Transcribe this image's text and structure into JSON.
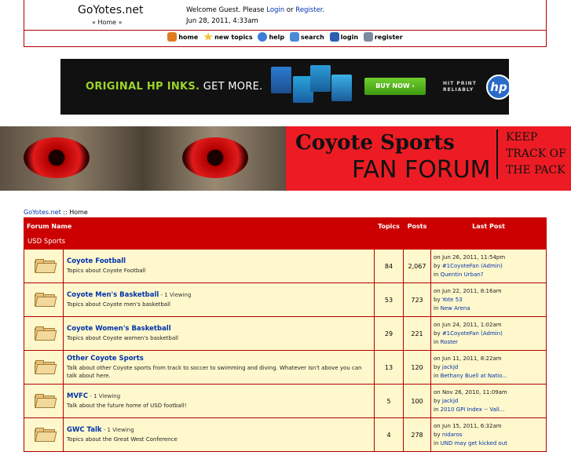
{
  "header": {
    "site_title": "GoYotes.net",
    "home_crumb": "« Home »",
    "welcome_prefix": "Welcome Guest. Please ",
    "login_link": "Login",
    "or_text": " or ",
    "register_link": "Register",
    "welcome_suffix": ".",
    "date": "Jun 28, 2011, 4:33am"
  },
  "toolbar": [
    {
      "label": "home",
      "icon": "home-icon",
      "color": "#e07b20"
    },
    {
      "label": "new topics",
      "icon": "star-icon",
      "color": "#f1c232"
    },
    {
      "label": "help",
      "icon": "help-icon",
      "color": "#3d7fd6"
    },
    {
      "label": "search",
      "icon": "search-icon",
      "color": "#4a8bd8"
    },
    {
      "label": "login",
      "icon": "login-icon",
      "color": "#2c5fb0"
    },
    {
      "label": "register",
      "icon": "register-icon",
      "color": "#7c8ca0"
    }
  ],
  "ad": {
    "headline_green": "ORIGINAL HP INKS.",
    "headline_white": " GET MORE.",
    "buy_button": "BUY NOW ›",
    "tagline_1": "HIT PRINT",
    "tagline_2": "RELIABLY",
    "logo": "hp"
  },
  "banner": {
    "title_1": "Coyote Sports",
    "title_2": "FAN FORUM",
    "side_1": "KEEP",
    "side_2": "TRACK OF",
    "side_3": "THE PACK"
  },
  "breadcrumb": {
    "site": "GoYotes.net",
    "sep": " :: ",
    "current": "Home"
  },
  "forum_table": {
    "headers": {
      "name": "Forum Name",
      "topics": "Topics",
      "posts": "Posts",
      "last_post": "Last Post"
    },
    "category": "USD Sports",
    "rows": [
      {
        "name": "Coyote Football",
        "viewing": "",
        "desc": "Topics about Coyote Football",
        "topics": "84",
        "posts": "2,067",
        "last_date": "on Jun 26, 2011, 11:54pm",
        "last_by": "#1CoyoteFan (Admin)",
        "last_in": "Quentin Urban?"
      },
      {
        "name": "Coyote Men's Basketball",
        "viewing": " - 1 Viewing",
        "desc": "Topics about Coyote men's basketball",
        "topics": "53",
        "posts": "723",
        "last_date": "on Jun 22, 2011, 8:16am",
        "last_by": "Yote 53",
        "last_in": "New Arena"
      },
      {
        "name": "Coyote Women's Basketball",
        "viewing": "",
        "desc": "Topics about Coyote women's basketball",
        "topics": "29",
        "posts": "221",
        "last_date": "on Jun 24, 2011, 1:02am",
        "last_by": "#1CoyoteFan (Admin)",
        "last_in": "Roster"
      },
      {
        "name": "Other Coyote Sports",
        "viewing": "",
        "desc": "Talk about other Coyote sports from track to soccer to swimming and diving. Whatever isn't above you can talk about here.",
        "topics": "13",
        "posts": "120",
        "last_date": "on Jun 11, 2011, 8:22am",
        "last_by": "jackjd",
        "last_in": "Bethany Buell at Natio..."
      },
      {
        "name": "MVFC",
        "viewing": " - 1 Viewing",
        "desc": "Talk about the future home of USD football!",
        "topics": "5",
        "posts": "100",
        "last_date": "on Nov 26, 2010, 11:09am",
        "last_by": "jackjd",
        "last_in": "2010 GPI Index -- Vall..."
      },
      {
        "name": "GWC Talk",
        "viewing": " - 1 Viewing",
        "desc": "Topics about the Great West Conference",
        "topics": "4",
        "posts": "278",
        "last_date": "on Jun 15, 2011, 6:32am",
        "last_by": "nidaros",
        "last_in": "UND may get kicked out"
      }
    ]
  }
}
